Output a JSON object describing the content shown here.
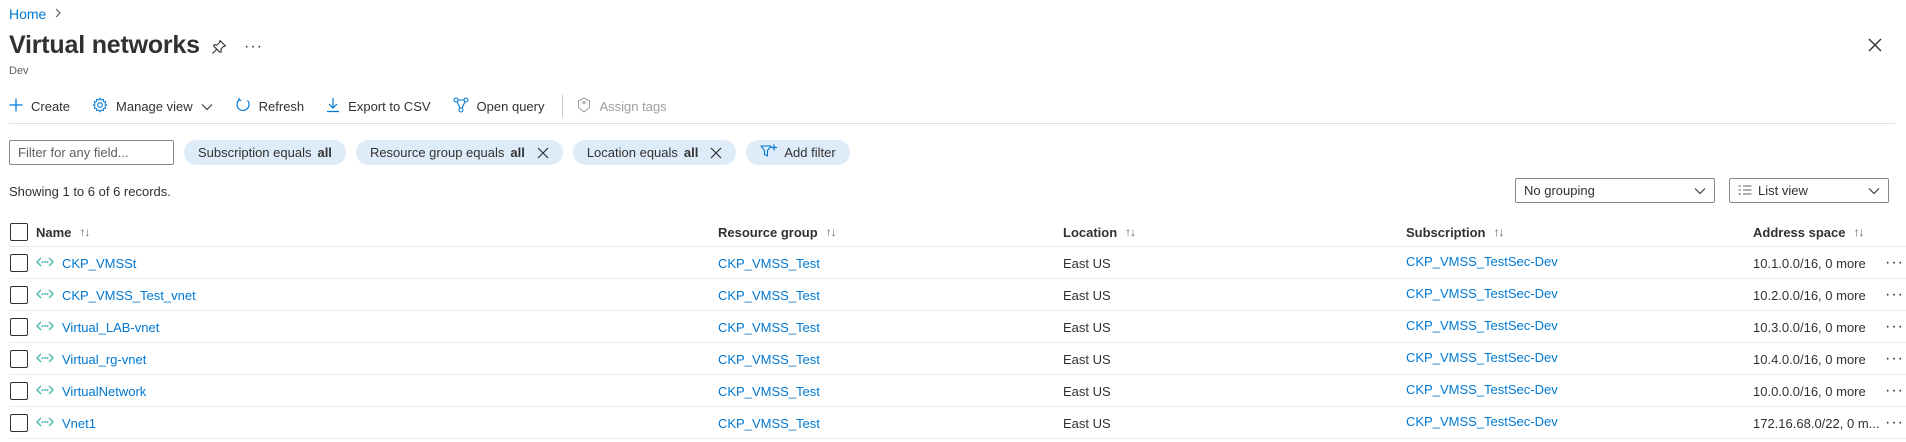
{
  "breadcrumb": {
    "home": "Home"
  },
  "header": {
    "title": "Virtual networks",
    "subtitle": "Dev",
    "more": "···"
  },
  "toolbar": {
    "create": "Create",
    "manage_view": "Manage view",
    "refresh": "Refresh",
    "export_csv": "Export to CSV",
    "open_query": "Open query",
    "assign_tags": "Assign tags"
  },
  "filters": {
    "placeholder": "Filter for any field...",
    "subscription": {
      "label": "Subscription equals",
      "value": "all"
    },
    "resource_group": {
      "label": "Resource group equals",
      "value": "all"
    },
    "location": {
      "label": "Location equals",
      "value": "all"
    },
    "add_filter": "Add filter"
  },
  "records": {
    "showing": "Showing 1 to 6 of 6 records."
  },
  "grouping": {
    "selected": "No grouping"
  },
  "view": {
    "selected": "List view"
  },
  "table": {
    "columns": {
      "name": "Name",
      "resource_group": "Resource group",
      "location": "Location",
      "subscription": "Subscription",
      "address_space": "Address space"
    },
    "sort_glyph": "↑↓",
    "rows": [
      {
        "name": "CKP_VMSSt",
        "resource_group": "CKP_VMSS_Test",
        "location": "East US",
        "subscription": "CKP_VMSS_TestSec-Dev",
        "address_space": "10.1.0.0/16, 0 more"
      },
      {
        "name": "CKP_VMSS_Test_vnet",
        "resource_group": "CKP_VMSS_Test",
        "location": "East US",
        "subscription": "CKP_VMSS_TestSec-Dev",
        "address_space": "10.2.0.0/16, 0 more"
      },
      {
        "name": "Virtual_LAB-vnet",
        "resource_group": "CKP_VMSS_Test",
        "location": "East US",
        "subscription": "CKP_VMSS_TestSec-Dev",
        "address_space": "10.3.0.0/16, 0 more"
      },
      {
        "name": "Virtual_rg-vnet",
        "resource_group": "CKP_VMSS_Test",
        "location": "East US",
        "subscription": "CKP_VMSS_TestSec-Dev",
        "address_space": "10.4.0.0/16, 0 more"
      },
      {
        "name": "VirtualNetwork",
        "resource_group": "CKP_VMSS_Test",
        "location": "East US",
        "subscription": "CKP_VMSS_TestSec-Dev",
        "address_space": "10.0.0.0/16, 0 more"
      },
      {
        "name": "Vnet1",
        "resource_group": "CKP_VMSS_Test",
        "location": "East US",
        "subscription": "CKP_VMSS_TestSec-Dev",
        "address_space": "172.16.68.0/22, 0 m..."
      }
    ],
    "row_more": "···"
  },
  "colors": {
    "accent": "#0078d4",
    "pill_bg": "#deecf9",
    "vnet_icon": "#50b9b0"
  },
  "icons": [
    "chevron-right-icon",
    "pin-icon",
    "close-icon",
    "plus-icon",
    "gear-icon",
    "chevron-down-icon",
    "refresh-icon",
    "download-icon",
    "query-icon",
    "tag-icon",
    "filter-add-icon",
    "list-icon",
    "vnet-icon"
  ]
}
